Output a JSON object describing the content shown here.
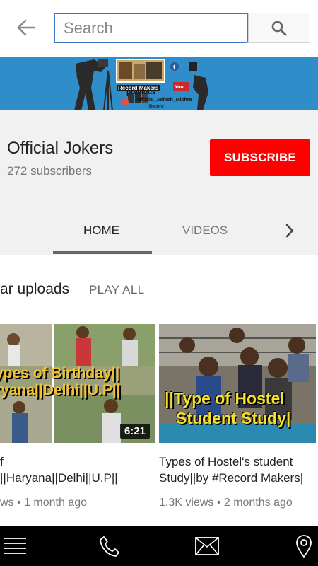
{
  "search": {
    "placeholder": "Search",
    "back_icon": "arrow-left-icon",
    "search_icon": "magnifier-icon"
  },
  "banner": {
    "brand": "Record Makers",
    "previous": "previous",
    "handle": "Official_Ashish_Mishra",
    "sub": "Record"
  },
  "channel": {
    "name": "Official Jokers",
    "subscribers": "272 subscribers",
    "subscribe_label": "SUBSCRIBE",
    "subscribe_color": "#ff0000"
  },
  "tabs": [
    {
      "label": "HOME",
      "active": true
    },
    {
      "label": "VIDEOS",
      "active": false
    }
  ],
  "section": {
    "title": "ar uploads",
    "play_all": "PLAY ALL"
  },
  "videos": [
    {
      "thumb_line1": "ypes of Birthday||",
      "thumb_line2": "ryana||Delhi||U.P||",
      "duration": "6:21",
      "title_line1": "f",
      "title_line2": "||Haryana||Delhi||U.P||",
      "meta": "ws • 1 month ago"
    },
    {
      "thumb_line1": "||Type of Hostel",
      "thumb_line2": "Student Study|",
      "title_line1": "Types of Hostel's student",
      "title_line2": "Study||by #Record Makers|",
      "meta": "1.3K views • 2 months ago"
    }
  ],
  "bottom_nav": [
    "menu-icon",
    "phone-icon",
    "mail-icon",
    "location-pin-icon"
  ]
}
